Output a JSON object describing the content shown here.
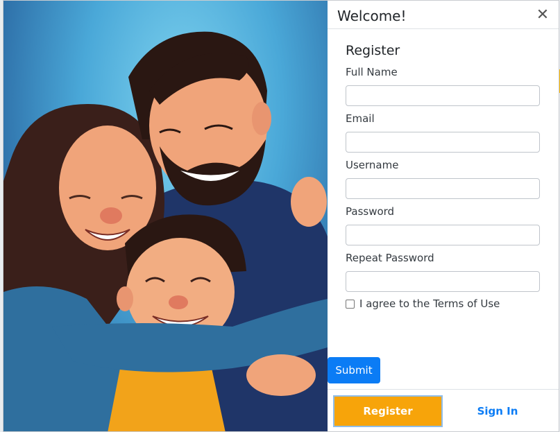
{
  "modal": {
    "title": "Welcome!",
    "close_icon": "close-icon",
    "close_glyph": "✕"
  },
  "illustration": {
    "subject": "family-hug-illustration"
  },
  "form": {
    "heading": "Register",
    "fields": [
      {
        "label": "Full Name",
        "value": "",
        "placeholder": ""
      },
      {
        "label": "Email",
        "value": "",
        "placeholder": ""
      },
      {
        "label": "Username",
        "value": "",
        "placeholder": ""
      },
      {
        "label": "Password",
        "value": "",
        "placeholder": ""
      },
      {
        "label": "Repeat Password",
        "value": "",
        "placeholder": ""
      }
    ],
    "terms_label": "I agree to the Terms of Use",
    "terms_checked": false,
    "submit_label": "Submit"
  },
  "footer": {
    "register_label": "Register",
    "signin_label": "Sign In"
  },
  "colors": {
    "primary": "#0b7cf5",
    "accent": "#f7a40a",
    "sky": "#4aa8d8"
  }
}
